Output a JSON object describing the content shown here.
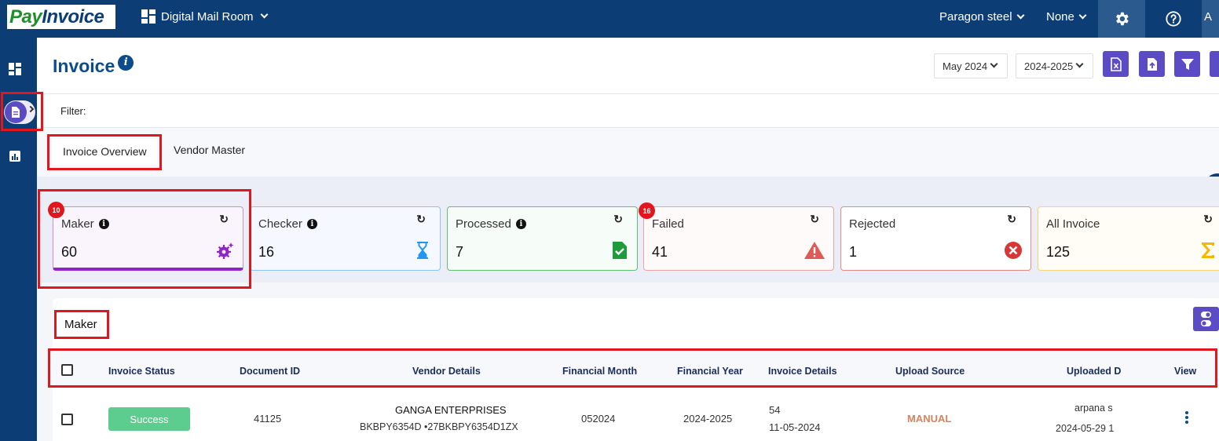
{
  "app": {
    "logo_part1": "Pay",
    "logo_part2": "Invoice",
    "module_label": "Digital Mail Room",
    "company_selector": "Paragon steel",
    "secondary_selector": "None",
    "user_initial": "A"
  },
  "page": {
    "title": "Invoice",
    "month_filter": "May 2024",
    "year_filter": "2024-2025",
    "filter_label": "Filter:"
  },
  "tabs": [
    {
      "label": "Invoice Overview",
      "active": true
    },
    {
      "label": "Vendor Master",
      "active": false
    }
  ],
  "cards": [
    {
      "label": "Maker",
      "value": "60",
      "badge": "10",
      "accent": "#8e24c9",
      "icon": "gears-icon"
    },
    {
      "label": "Checker",
      "value": "16",
      "accent": "#2196f3",
      "icon": "hourglass-icon"
    },
    {
      "label": "Processed",
      "value": "7",
      "accent": "#1e9b3b",
      "icon": "file-check-icon"
    },
    {
      "label": "Failed",
      "value": "41",
      "badge": "16",
      "accent": "#e05a55",
      "icon": "warning-icon"
    },
    {
      "label": "Rejected",
      "value": "1",
      "accent": "#d93636",
      "icon": "x-circle-icon"
    },
    {
      "label": "All Invoice",
      "value": "125",
      "accent": "#f5b800",
      "icon": "sigma-icon"
    }
  ],
  "section": {
    "title": "Maker"
  },
  "table": {
    "headers": [
      "Invoice Status",
      "Document ID",
      "Vendor Details",
      "Financial Month",
      "Financial Year",
      "Invoice Details",
      "Upload Source",
      "Uploaded D",
      "View"
    ],
    "rows": [
      {
        "status": "Success",
        "document_id": "41125",
        "vendor_name": "GANGA ENTERPRISES",
        "vendor_ids": "BKBPY6354D  •27BKBPY6354D1ZX",
        "financial_month": "052024",
        "financial_year": "2024-2025",
        "invoice_no": "54",
        "invoice_date": "11-05-2024",
        "upload_source": "MANUAL",
        "uploaded_by": "arpana s",
        "uploaded_date": "2024-05-29 1"
      }
    ]
  },
  "colors": {
    "topbar": "#0c3d75",
    "primary_button": "#5b4bc4",
    "annotation": "#e2171d",
    "success": "#5ccd8e",
    "manual": "#d9825b"
  }
}
